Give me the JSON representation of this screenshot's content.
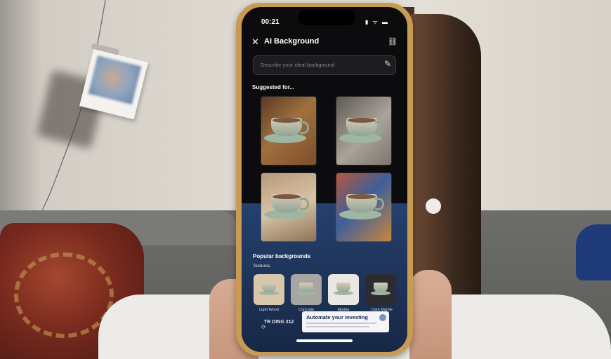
{
  "status_bar": {
    "time": "00:21",
    "icons": "▮ ᯤ ▬"
  },
  "header": {
    "title": "AI Background",
    "close_icon": "close-icon",
    "link_icon": "link-icon"
  },
  "search": {
    "placeholder": "Describe your ideal background"
  },
  "suggested": {
    "heading": "Suggested for...",
    "tiles": [
      {
        "bg": "linear-gradient(135deg,#5a3a24 0%,#a0703f 45%,#7d4f2a 100%)"
      },
      {
        "bg": "linear-gradient(135deg,#5f5a52 0%,#a9a39a 55%,#7c766d 100%)"
      },
      {
        "bg": "linear-gradient(160deg,#b69a7a 0%,#d8c3a4 50%,#8d7357 100%)"
      },
      {
        "bg": "linear-gradient(135deg,#b5563c 0%,#3d5f9a 45%,#c9863d 100%)"
      }
    ]
  },
  "popular": {
    "heading": "Popular backgrounds",
    "subheading": "Textures",
    "items": [
      {
        "label": "Light Wood",
        "bg": "#d8c7ab"
      },
      {
        "label": "Concrete",
        "bg": "#a7a6a3"
      },
      {
        "label": "Marble",
        "bg": "#eae7e2"
      },
      {
        "label": "Dark Marble",
        "bg": "#2c2c30"
      }
    ]
  },
  "ad": {
    "title": "Automate your investing"
  },
  "ticker": {
    "text": "TR DING 212"
  }
}
